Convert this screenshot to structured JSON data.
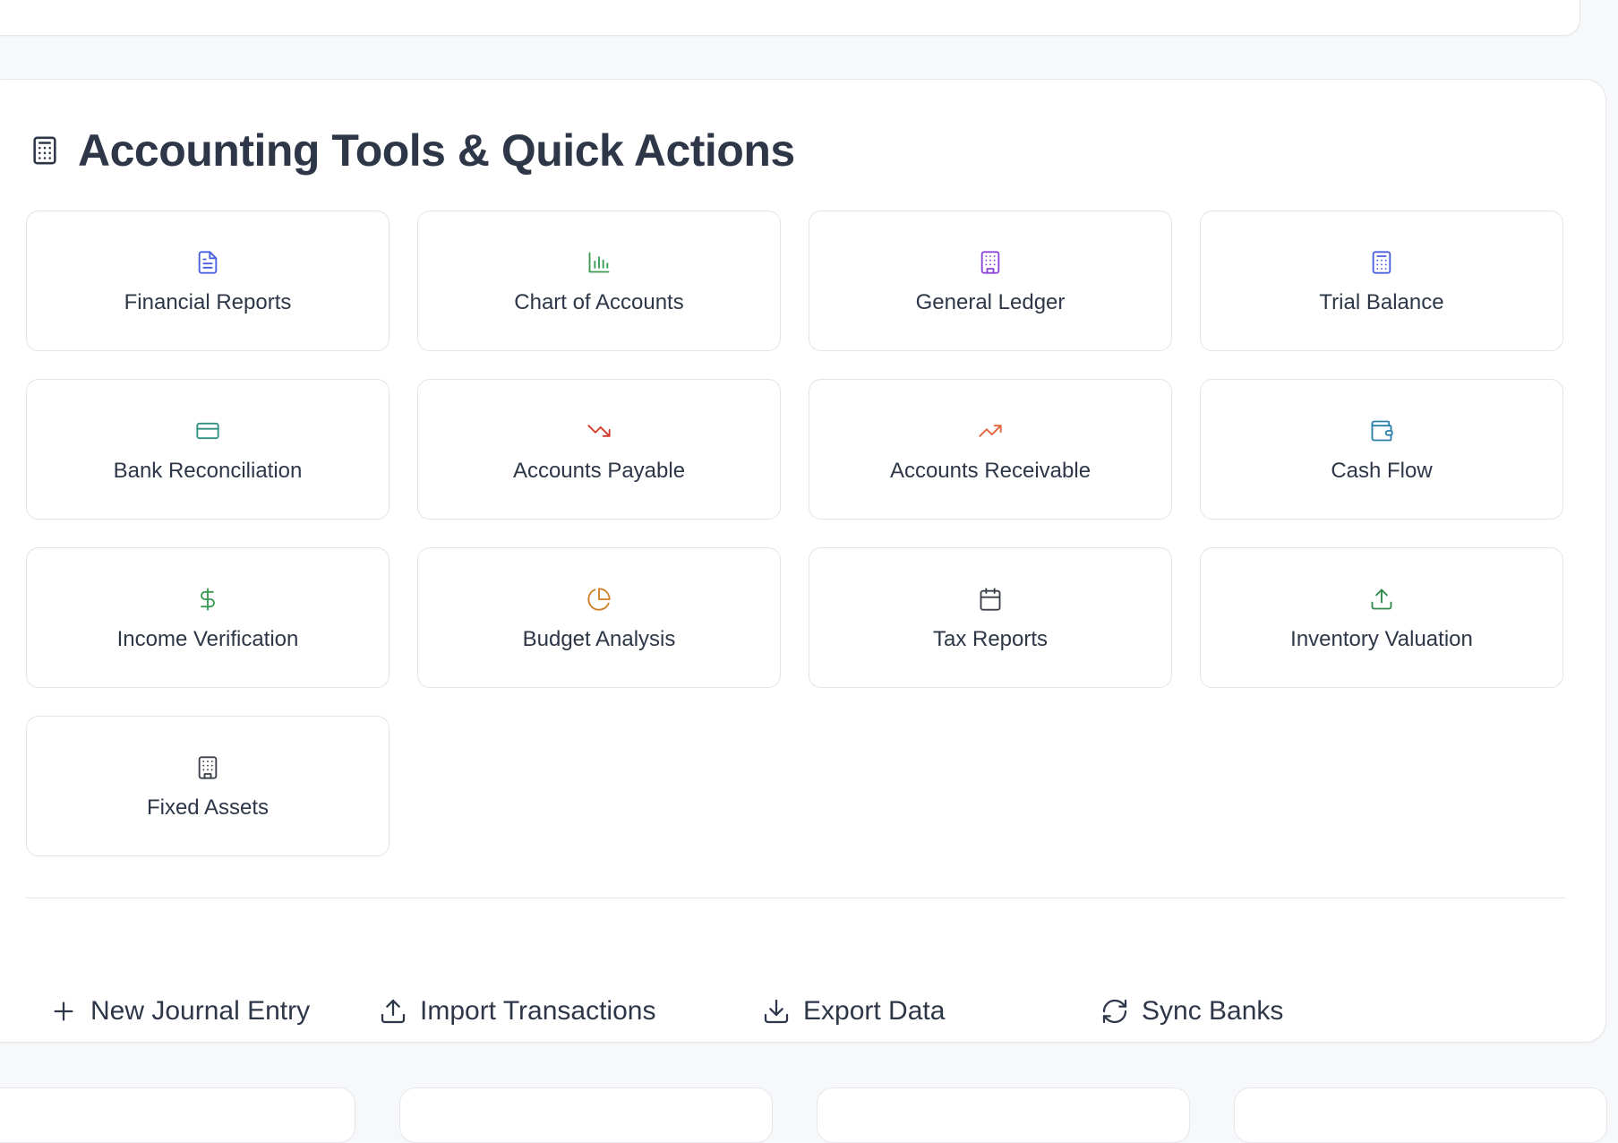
{
  "section": {
    "title": "Accounting Tools & Quick Actions",
    "icon": "calculator-icon"
  },
  "tools": [
    {
      "label": "Financial Reports",
      "icon": "file-text-icon",
      "color": "#4a5ee0"
    },
    {
      "label": "Chart of Accounts",
      "icon": "bar-chart-icon",
      "color": "#3a9a52"
    },
    {
      "label": "General Ledger",
      "icon": "building-icon",
      "color": "#8b45d8"
    },
    {
      "label": "Trial Balance",
      "icon": "calculator-icon",
      "color": "#4a5ee0"
    },
    {
      "label": "Bank Reconciliation",
      "icon": "credit-card-icon",
      "color": "#2f8f80"
    },
    {
      "label": "Accounts Payable",
      "icon": "trending-down-icon",
      "color": "#d03a2a"
    },
    {
      "label": "Accounts Receivable",
      "icon": "trending-up-icon",
      "color": "#e2643a"
    },
    {
      "label": "Cash Flow",
      "icon": "wallet-icon",
      "color": "#2b7fa8"
    },
    {
      "label": "Income Verification",
      "icon": "dollar-sign-icon",
      "color": "#3a9a52"
    },
    {
      "label": "Budget Analysis",
      "icon": "pie-chart-icon",
      "color": "#d0802a"
    },
    {
      "label": "Tax Reports",
      "icon": "calendar-icon",
      "color": "#3a3f4a"
    },
    {
      "label": "Inventory Valuation",
      "icon": "upload-icon",
      "color": "#2f8a4a"
    },
    {
      "label": "Fixed Assets",
      "icon": "building-icon",
      "color": "#3a3f4a"
    }
  ],
  "actions": [
    {
      "label": "New Journal Entry",
      "icon": "plus-icon"
    },
    {
      "label": "Import Transactions",
      "icon": "upload-icon"
    },
    {
      "label": "Export Data",
      "icon": "download-icon"
    },
    {
      "label": "Sync Banks",
      "icon": "refresh-icon"
    }
  ],
  "colors": {
    "text": "#2d3748",
    "border": "#e2e4e8",
    "background": "#f7f8fa"
  }
}
